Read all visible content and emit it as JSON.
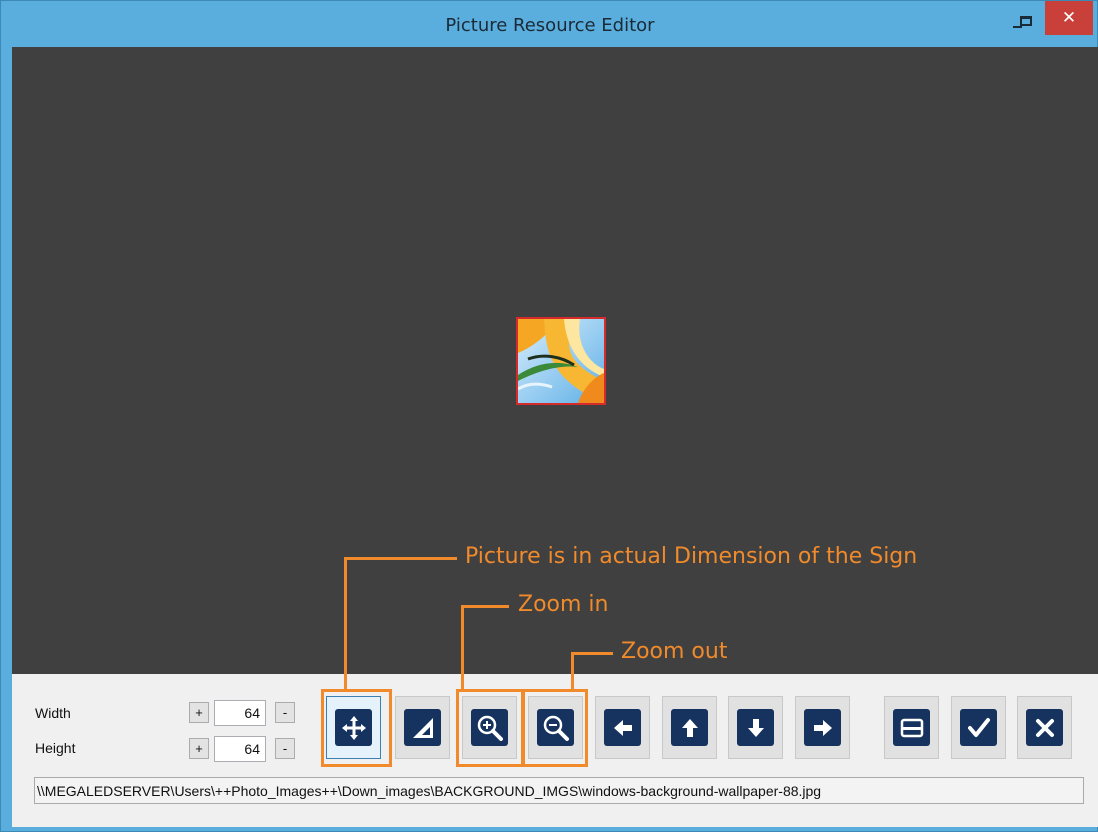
{
  "window": {
    "title": "Picture Resource Editor",
    "close_glyph": "✕"
  },
  "annotations": {
    "actual_dimension": "Picture is in actual Dimension of the Sign",
    "zoom_in": "Zoom in",
    "zoom_out": "Zoom out",
    "color": "#f08a2a"
  },
  "size_controls": {
    "width_label": "Width",
    "height_label": "Height",
    "width_value": "64",
    "height_value": "64",
    "plus": "+",
    "minus": "-"
  },
  "toolbar": {
    "icons": [
      "move-icon",
      "actual-size-icon",
      "zoom-in-icon",
      "zoom-out-icon",
      "arrow-left-icon",
      "arrow-up-icon",
      "arrow-down-icon",
      "arrow-right-icon",
      "open-folder-icon",
      "check-icon",
      "cancel-icon"
    ],
    "icon_color": "#15335e"
  },
  "file_path": "\\\\MEGALEDSERVER\\Users\\++Photo_Images++\\Down_images\\BACKGROUND_IMGS\\windows-background-wallpaper-88.jpg"
}
